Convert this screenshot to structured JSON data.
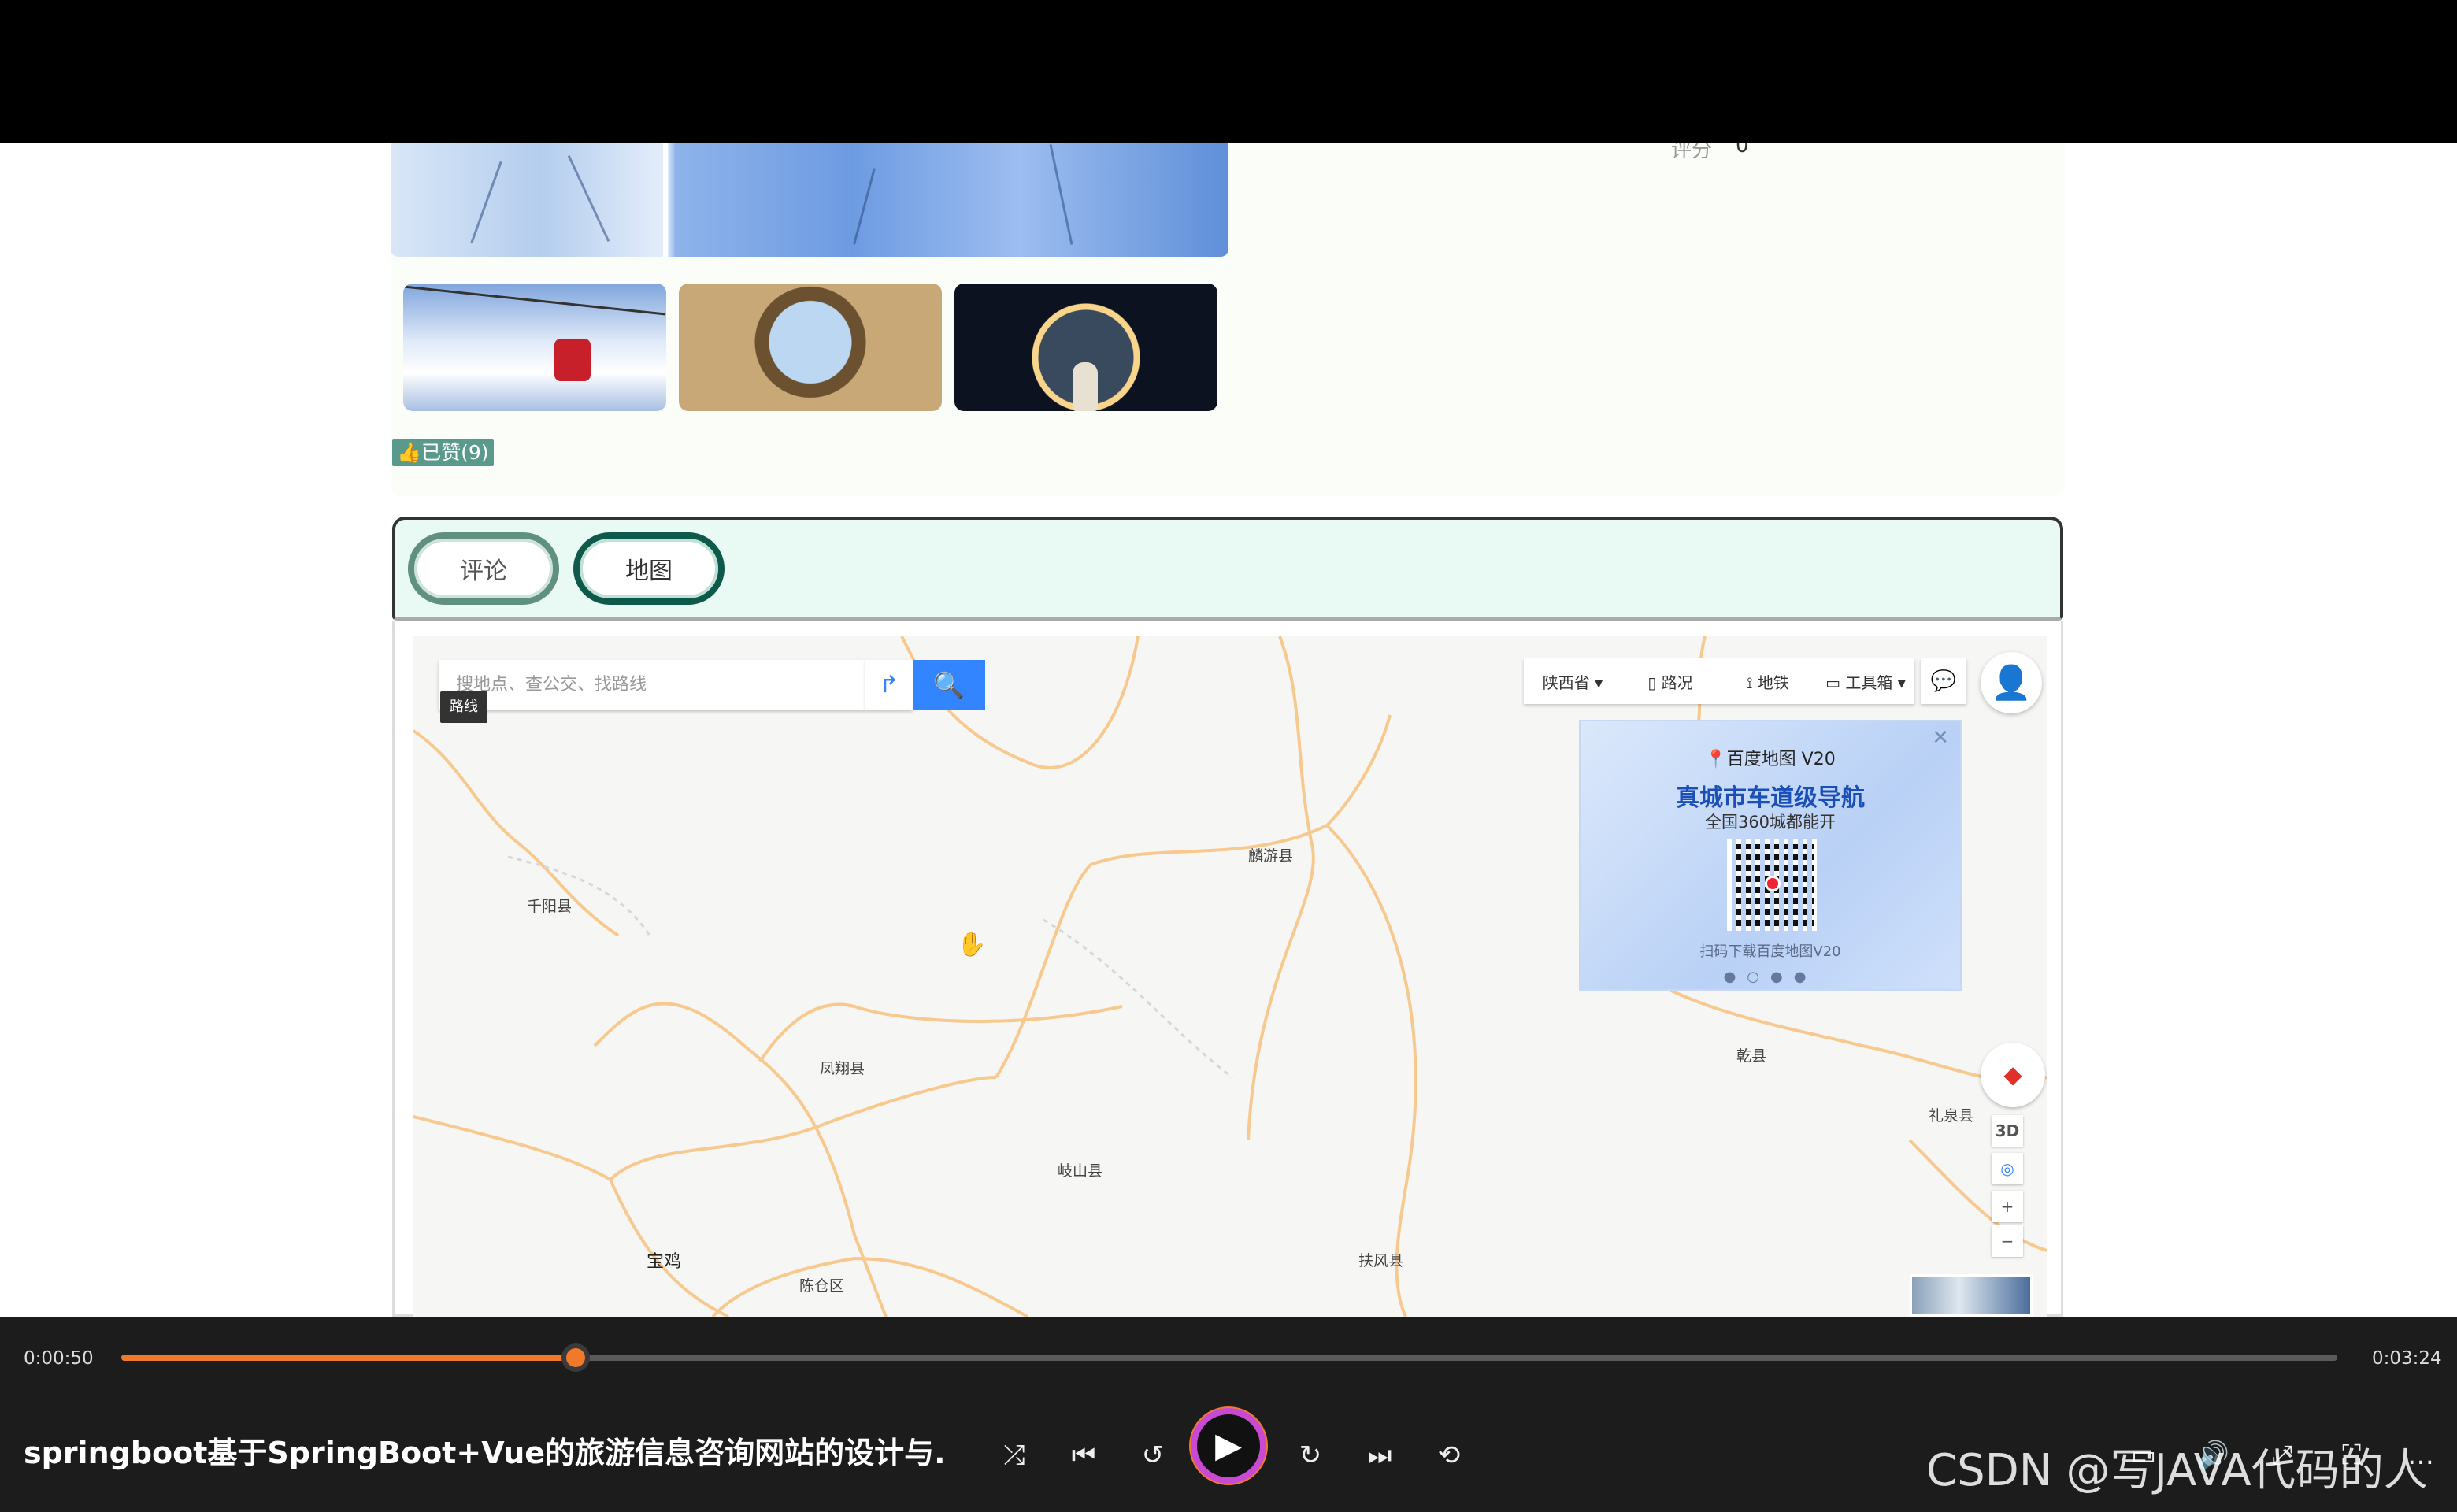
{
  "detail": {
    "score_label": "评分",
    "score_value": "0",
    "like_label": "已赞(9)"
  },
  "tabs": [
    {
      "label": "评论"
    },
    {
      "label": "地图"
    }
  ],
  "map": {
    "search_placeholder": "搜地点、查公交、找路线",
    "route_tooltip": "路线",
    "toolbar": {
      "province": "陕西省",
      "traffic": "路况",
      "subway": "地铁",
      "toolbox": "工具箱"
    },
    "ad": {
      "brand": "百度地图 V20",
      "headline": "真城市车道级导航",
      "sub": "全国360城都能开",
      "foot": "扫码下载百度地图V20"
    },
    "places": {
      "qianyang": "千阳县",
      "linyou": "麟游县",
      "fengxiang": "凤翔县",
      "qishan": "岐山县",
      "qianxian": "乾县",
      "liquan": "礼泉县",
      "baoji": "宝鸡",
      "chencang": "陈仓区",
      "fufeng": "扶风县"
    },
    "controls": {
      "three_d": "3D",
      "zoom_in": "+",
      "zoom_out": "−"
    }
  },
  "player": {
    "current_time": "0:00:50",
    "total_time": "0:03:24",
    "progress": 0.205,
    "title": "springboot基于SpringBoot+Vue的旅游信息咨询网站的设计与...",
    "watermark": "CSDN @写JAVA代码的人",
    "accent": "#f07a2a"
  }
}
